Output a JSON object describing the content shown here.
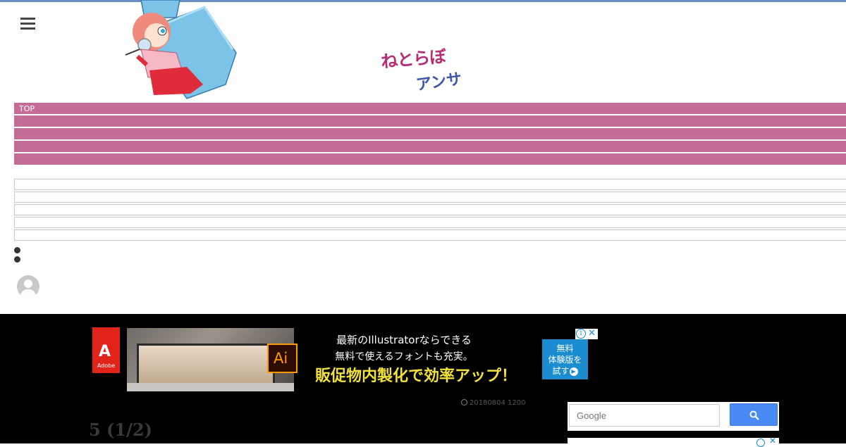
{
  "header": {
    "logo_line1": "ねとらぼ",
    "logo_line2": "アンサー",
    "menu_icon": "hamburger-icon",
    "mascot_icon": "detective-mascot-illustration"
  },
  "nav": {
    "items": [
      "TOP",
      "",
      "",
      "",
      ""
    ],
    "color": "#c56c96"
  },
  "ad_banner": {
    "brand": "Adobe",
    "product_badge": "Ai",
    "line1": "最新のIllustratorならできる",
    "line2": "無料で使えるフォントも充実。",
    "headline": "販促物内製化で効率アップ！",
    "cta": [
      "無料",
      "体験版を",
      "試す"
    ],
    "adchoices_icon": "info-icon",
    "close_icon": "close-icon"
  },
  "article": {
    "date": "20180804 1200",
    "title": "5 (1/2)"
  },
  "search": {
    "placeholder": "Google",
    "button_icon": "search-icon"
  }
}
